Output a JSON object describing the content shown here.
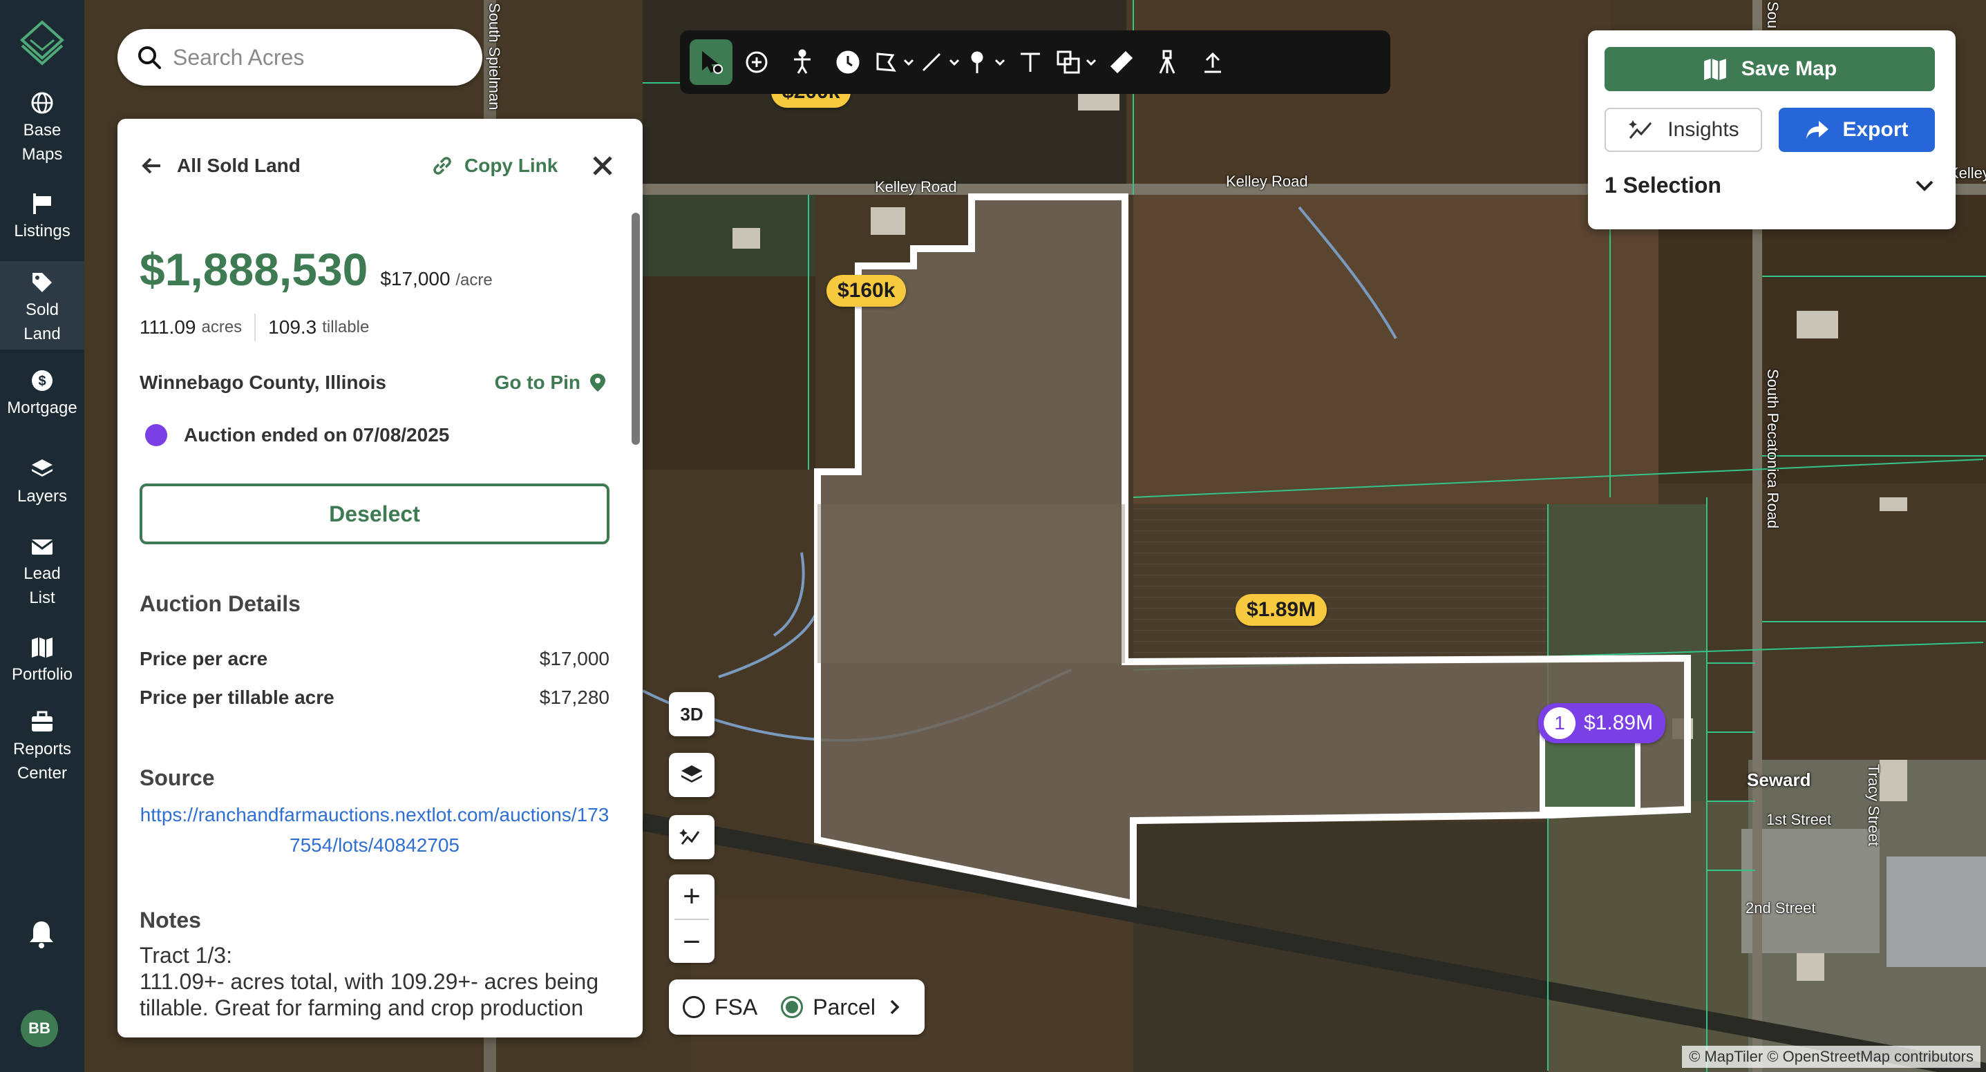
{
  "colors": {
    "brand_green": "#3e7a52",
    "export_blue": "#2766d9",
    "auction_purple": "#7a40e6",
    "price_yellow": "#f7c93e",
    "sidebar_bg": "#1b2a33"
  },
  "sidebar": {
    "items": [
      {
        "label_line1": "Base",
        "label_line2": "Maps",
        "icon": "globe-icon"
      },
      {
        "label_line1": "Listings",
        "label_line2": "",
        "icon": "sign-icon"
      },
      {
        "label_line1": "Sold",
        "label_line2": "Land",
        "icon": "tag-icon",
        "active": true
      },
      {
        "label_line1": "Mortgage",
        "label_line2": "",
        "icon": "dollar-icon"
      },
      {
        "label_line1": "Layers",
        "label_line2": "",
        "icon": "layers-icon"
      },
      {
        "label_line1": "Lead",
        "label_line2": "List",
        "icon": "envelope-icon"
      },
      {
        "label_line1": "Portfolio",
        "label_line2": "",
        "icon": "map-icon"
      },
      {
        "label_line1": "Reports",
        "label_line2": "Center",
        "icon": "briefcase-icon"
      }
    ],
    "avatar_initials": "BB"
  },
  "search": {
    "placeholder": "Search Acres",
    "value": ""
  },
  "toolbar": {
    "tools": [
      "select-tool",
      "add-point-tool",
      "person-tool",
      "history-tool",
      "polygon-tool",
      "line-tool",
      "pin-tool",
      "text-tool",
      "shape-tool",
      "ruler-tool",
      "survey-tool",
      "upload-tool"
    ],
    "active": "select-tool"
  },
  "panel": {
    "back_label": "All Sold Land",
    "copy_link_label": "Copy Link",
    "price": "$1,888,530",
    "price_per_acre": "$17,000",
    "per_acre_unit": "/acre",
    "acres": "111.09",
    "acres_label": "acres",
    "tillable": "109.3",
    "tillable_label": "tillable",
    "county": "Winnebago County, Illinois",
    "go_to_pin": "Go to Pin",
    "auction_status": "Auction ended on 07/08/2025",
    "deselect_label": "Deselect",
    "auction_details_title": "Auction Details",
    "details": [
      {
        "key": "Price per acre",
        "value": "$17,000"
      },
      {
        "key": "Price per tillable acre",
        "value": "$17,280"
      }
    ],
    "source_title": "Source",
    "source_url": "https://ranchandfarmauctions.nextlot.com/auctions/1737554/lots/40842705",
    "notes_title": "Notes",
    "notes_line1": "Tract 1/3:",
    "notes_line2": "111.09+- acres total, with 109.29+- acres being tillable. Great for farming and crop production"
  },
  "map": {
    "roads": [
      "Kelley Road",
      "Kelley Road",
      "South Spielman",
      "South Pecatonica Road",
      "Tracy Street",
      "1st Street",
      "2nd Street",
      "Kelley",
      "Sou"
    ],
    "town": "Seward",
    "price_labels": [
      "$200k",
      "$160k",
      "$1.89M"
    ],
    "selected_label": {
      "number": "1",
      "price": "$1.89M"
    },
    "attribution": "© MapTiler © OpenStreetMap contributors",
    "controls": {
      "three_d": "3D"
    },
    "layer_toggle": {
      "fsa": "FSA",
      "parcel": "Parcel",
      "selected": "Parcel"
    }
  },
  "right_card": {
    "save_map": "Save Map",
    "insights": "Insights",
    "export": "Export",
    "selection": "1 Selection"
  }
}
